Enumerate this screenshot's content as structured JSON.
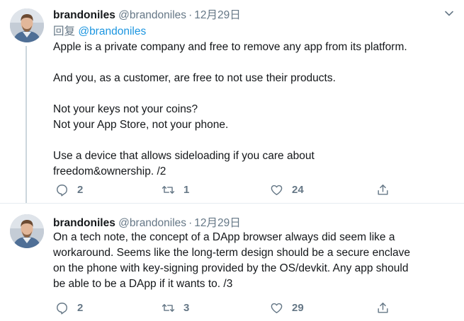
{
  "tweets": [
    {
      "name": "brandoniles",
      "handle": "@brandoniles",
      "separator": "·",
      "date": "12月29日",
      "reply_prefix": "回复",
      "reply_mention": "@brandoniles",
      "paragraphs": [
        "Apple is a private company and free to remove any app from its platform.",
        "And you, as a customer, are free to not use their products.",
        "Not your keys not your coins?\nNot your App Store, not your phone.",
        "Use a device that allows sideloading if you care about\nfreedom&ownership. /2"
      ],
      "replies": "2",
      "retweets": "1",
      "likes": "24"
    },
    {
      "name": "brandoniles",
      "handle": "@brandoniles",
      "separator": "·",
      "date": "12月29日",
      "text": "On a tech note, the concept of a DApp browser always did seem like a\nworkaround. Seems like the long-term design should be a secure enclave\non the phone with key-signing provided by the OS/devkit. Any app should\nbe able to be a DApp if it wants to. /3",
      "replies": "2",
      "retweets": "3",
      "likes": "29"
    }
  ],
  "icons": {
    "reply": "reply-icon",
    "retweet": "retweet-icon",
    "like": "heart-icon",
    "share": "share-icon",
    "more": "chevron-down-icon"
  },
  "colors": {
    "text": "#14171a",
    "secondary": "#657786",
    "link": "#1b95e0",
    "thread_line": "#ccd6dd"
  }
}
